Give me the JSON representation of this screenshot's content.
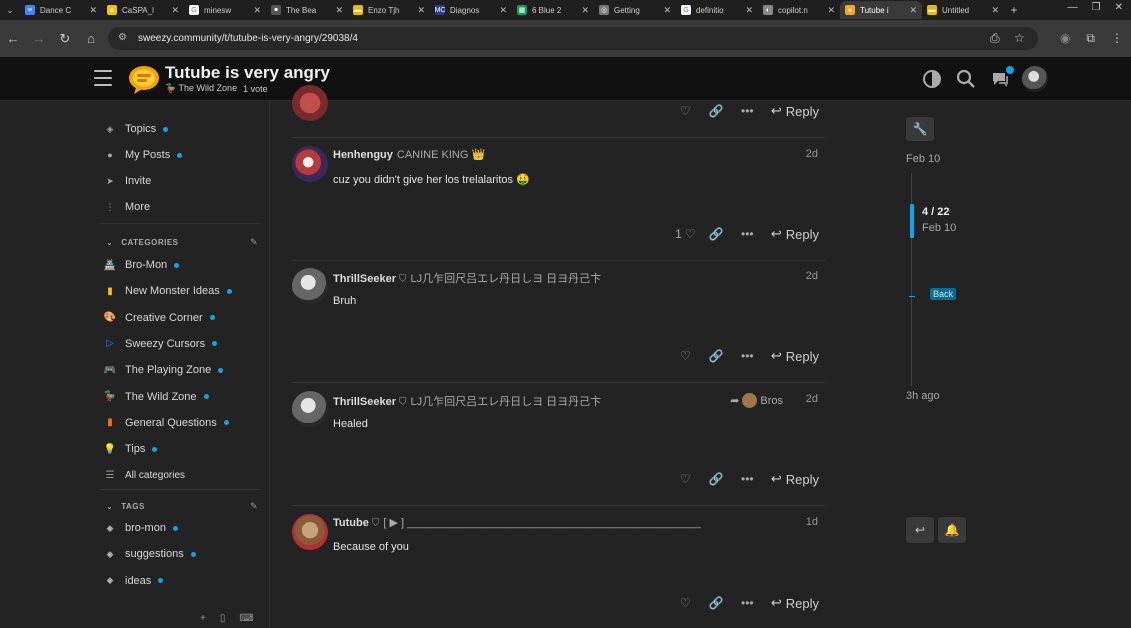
{
  "browser": {
    "tabs": [
      {
        "label": "Dance C",
        "color": "#4285f4",
        "glyph": "≡"
      },
      {
        "label": "CaSPA_l",
        "color": "#fbbc04",
        "glyph": "▲"
      },
      {
        "label": "minesw",
        "color": "#ffffff",
        "glyph": "G"
      },
      {
        "label": "The Bea",
        "color": "#555555",
        "glyph": "⚫"
      },
      {
        "label": "Enzo Tjh",
        "color": "#f4b400",
        "glyph": "▬"
      },
      {
        "label": "Diagnos",
        "color": "#2a3f8f",
        "glyph": "MC"
      },
      {
        "label": "6 Blue 2",
        "color": "#0f9d58",
        "glyph": "▦"
      },
      {
        "label": "Getting",
        "color": "#777777",
        "glyph": "◎"
      },
      {
        "label": "definitio",
        "color": "#ffffff",
        "glyph": "G"
      },
      {
        "label": "copilot.n",
        "color": "#888888",
        "glyph": "◐"
      },
      {
        "label": "Tutube i",
        "color": "#f5a623",
        "glyph": "●"
      },
      {
        "label": "Untitled",
        "color": "#f4b400",
        "glyph": "▬"
      }
    ],
    "active_tab_index": 10,
    "url": "sweezy.community/t/tutube-is-very-angry/29038/4"
  },
  "header": {
    "title": "Tutube is very angry",
    "category": "The Wild Zone",
    "votes": "1 vote"
  },
  "sidebar": {
    "nav": [
      {
        "label": "Topics",
        "icon": "layers-icon",
        "dot": true
      },
      {
        "label": "My Posts",
        "icon": "user-icon",
        "dot": true
      },
      {
        "label": "Invite",
        "icon": "paper-plane-icon",
        "dot": false
      },
      {
        "label": "More",
        "icon": "more-vertical-icon",
        "dot": false
      }
    ],
    "categories_heading": "CATEGORIES",
    "categories": [
      {
        "label": "Bro-Mon",
        "emoji": "🏯",
        "dot": true
      },
      {
        "label": "New Monster Ideas",
        "emoji": "▮",
        "dot": true
      },
      {
        "label": "Creative Corner",
        "emoji": "🎨",
        "dot": true
      },
      {
        "label": "Sweezy Cursors",
        "emoji": "▷",
        "dot": true
      },
      {
        "label": "The Playing Zone",
        "emoji": "🎮",
        "dot": true
      },
      {
        "label": "The Wild Zone",
        "emoji": "🦆",
        "dot": true
      },
      {
        "label": "General Questions",
        "emoji": "▮",
        "dot": true
      },
      {
        "label": "Tips",
        "emoji": "💡",
        "dot": true
      },
      {
        "label": "All categories",
        "emoji": "☰",
        "dot": false
      }
    ],
    "tags_heading": "TAGS",
    "tags": [
      {
        "label": "bro-mon",
        "dot": true
      },
      {
        "label": "suggestions",
        "dot": true
      },
      {
        "label": "ideas",
        "dot": true
      }
    ]
  },
  "posts": [
    {
      "user": "Henhenguy",
      "title": "CANINE KING 👑",
      "date": "2d",
      "body": "cuz you didn't give her los trelalaritos 🤑",
      "likes": "1",
      "reply_to": "",
      "reply": "Reply"
    },
    {
      "user": "ThrillSeeker",
      "title": "LJ几乍回尺吕エレ丹日しヨ 日ヨ丹己卞",
      "date": "2d",
      "body": "Bruh",
      "likes": "",
      "reply_to": "",
      "reply": "Reply"
    },
    {
      "user": "ThrillSeeker",
      "title": "LJ几乍回尺吕エレ丹日しヨ 日ヨ丹己卞",
      "date": "2d",
      "body": "Healed",
      "likes": "",
      "reply_to": "Bros",
      "reply": "Reply"
    },
    {
      "user": "Tutube",
      "title": "[ ▶ ] ________________________________________________",
      "date": "1d",
      "body": "Because of you",
      "likes": "",
      "reply_to": "",
      "reply": "Reply"
    }
  ],
  "top_partial_post": {
    "reply": "Reply"
  },
  "timeline": {
    "start": "Feb 10",
    "position": "4 / 22",
    "position_date": "Feb 10",
    "back": "Back",
    "end": "3h ago"
  }
}
